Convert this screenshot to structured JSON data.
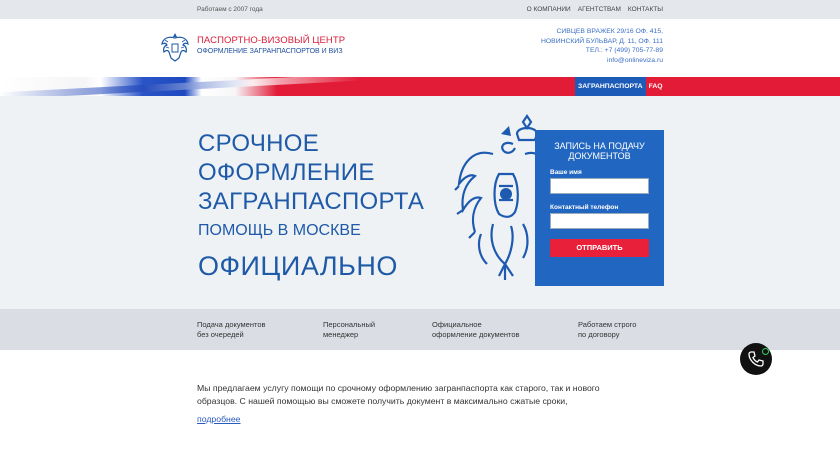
{
  "topbar": {
    "since": "Работаем с 2007 года",
    "nav": [
      "О КОМПАНИИ",
      "АГЕНТСТВАМ",
      "КОНТАКТЫ"
    ]
  },
  "header": {
    "brand_title": "ПАСПОРТНО-ВИЗОВЫЙ ЦЕНТР",
    "brand_subtitle": "ОФОРМЛЕНИЕ ЗАГРАНПАСПОРТОВ И ВИЗ",
    "address1": "СИВЦЕВ ВРАЖЕК 29/16 ОФ. 415,",
    "address2": "НОВИНСКИЙ БУЛЬВАР, Д. 11, ОФ. 111",
    "phone": "ТЕЛ.: +7 (499) 705-77-89",
    "email": "info@onlineviza.ru"
  },
  "nav": {
    "tabs": [
      "ЗАГРАНПАСПОРТА",
      "FAQ"
    ]
  },
  "hero": {
    "line1": "СРОЧНОЕ",
    "line2": "ОФОРМЛЕНИЕ",
    "line3": "ЗАГРАНПАСПОРТА",
    "sub": "ПОМОЩЬ В МОСКВЕ",
    "big": "ОФИЦИАЛЬНО"
  },
  "form": {
    "title_line1": "ЗАПИСЬ НА ПОДАЧУ",
    "title_line2": "ДОКУМЕНТОВ",
    "name_label": "Ваше имя",
    "name_value": "",
    "phone_label": "Контактный телефон",
    "phone_value": "",
    "submit": "ОТПРАВИТЬ"
  },
  "features": [
    {
      "line1": "Подача документов",
      "line2": "без очередей"
    },
    {
      "line1": "Персональный",
      "line2": "менеджер"
    },
    {
      "line1": "Официальное",
      "line2": "оформление документов"
    },
    {
      "line1": "Работаем строго",
      "line2": "по договору"
    }
  ],
  "content": {
    "line1": "Мы предлагаем услугу помощи по срочному оформлению загранпаспорта как старого, так и нового",
    "line2": "образцов. С нашей помощью вы сможете получить документ в максимально сжатые сроки,",
    "more": "подробнее"
  },
  "colors": {
    "brand_blue": "#1f5aa8",
    "accent_red": "#e8203a",
    "form_blue": "#2166c1"
  },
  "icons": {
    "logo": "coat-of-arms-icon",
    "call": "phone-icon"
  }
}
